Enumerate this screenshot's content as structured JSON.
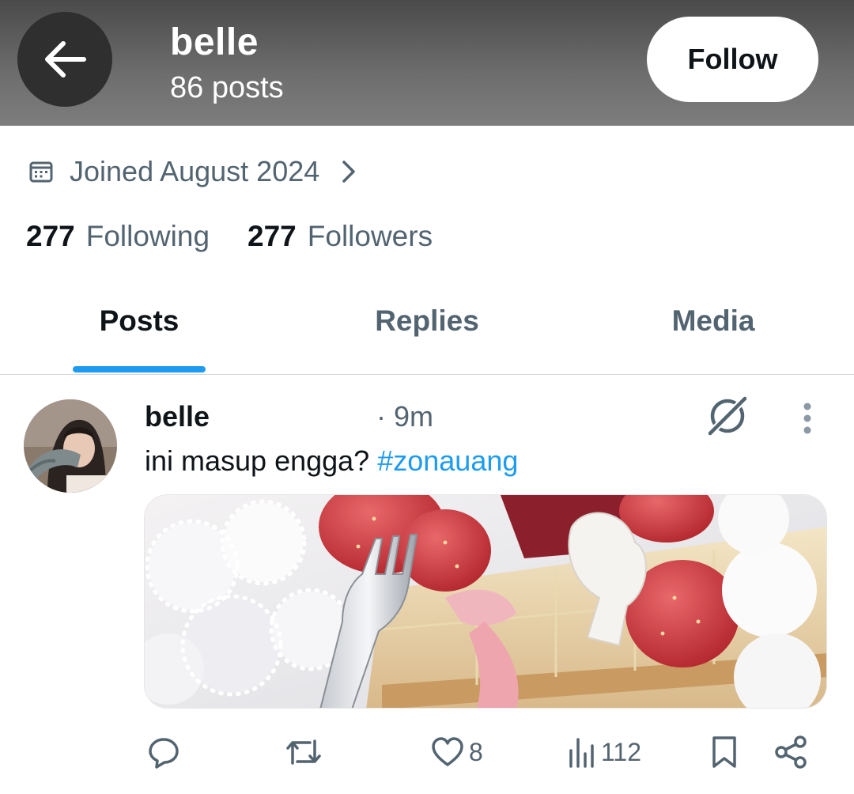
{
  "header": {
    "name": "belle",
    "posts_count": "86 posts",
    "follow_label": "Follow"
  },
  "profile": {
    "joined": "Joined August 2024",
    "following_count": "277",
    "following_label": "Following",
    "followers_count": "277",
    "followers_label": "Followers"
  },
  "tabs": [
    {
      "label": "Posts",
      "active": true
    },
    {
      "label": "Replies",
      "active": false
    },
    {
      "label": "Media",
      "active": false
    }
  ],
  "post": {
    "author": "belle",
    "time": "· 9m",
    "text": "ini masup engga?",
    "hashtag": "#zonauang",
    "actions": {
      "reply": "",
      "repost": "",
      "likes": "8",
      "views": "112"
    }
  },
  "colors": {
    "accent": "#1d9bf0",
    "text_primary": "#0f1419",
    "text_secondary": "#536471",
    "header_bg": "#6e6e6e"
  },
  "icons": [
    "back-arrow-icon",
    "calendar-icon",
    "chevron-right-icon",
    "grok-icon",
    "more-vertical-icon",
    "reply-icon",
    "repost-icon",
    "like-icon",
    "views-icon",
    "bookmark-icon",
    "share-icon"
  ]
}
